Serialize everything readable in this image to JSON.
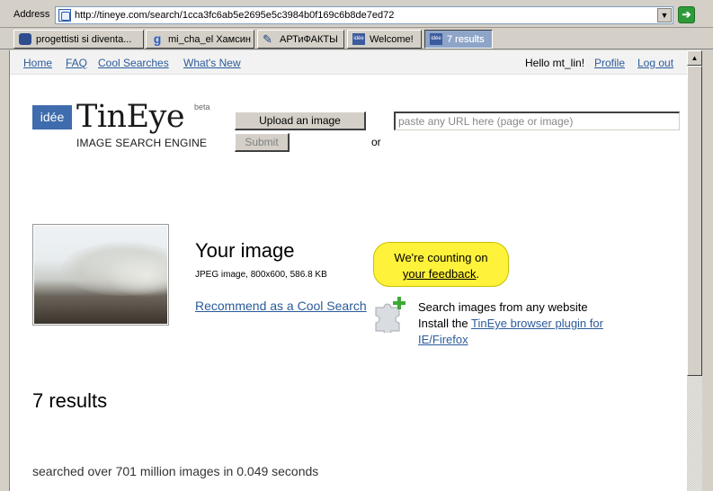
{
  "browser": {
    "address_label": "Address",
    "url": "http://tineye.com/search/1cca3fc6ab5e2695e5c3984b0f169c6b8de7ed72",
    "go_icon": "go-arrow-icon",
    "tabs": [
      {
        "label": "progettisti si diventa...",
        "icon": "person-icon"
      },
      {
        "label": "mi_cha_el Хамсин",
        "icon": "google-icon"
      },
      {
        "label": "АРТиФАКТЫ",
        "icon": "pen-icon"
      },
      {
        "label": "Welcome!",
        "icon": "idee-icon"
      },
      {
        "label": "7 results",
        "icon": "idee-icon"
      }
    ],
    "favicon_text": "idée"
  },
  "nav": {
    "home": "Home",
    "faq": "FAQ",
    "cool_searches": "Cool Searches",
    "whats_new": "What's New",
    "greeting": "Hello mt_lin!",
    "profile": "Profile",
    "logout": "Log out"
  },
  "logo": {
    "badge": "idée",
    "name": "TinEye",
    "beta": "beta",
    "subtitle": "IMAGE SEARCH ENGINE"
  },
  "search": {
    "upload_label": "Upload an image",
    "submit_label": "Submit",
    "or": "or",
    "url_placeholder": "paste any URL here (page or image)"
  },
  "image": {
    "heading": "Your image",
    "meta": "JPEG image, 800x600, 586.8 KB",
    "recommend": "Recommend as a Cool Search"
  },
  "feedback": {
    "line1": "We're counting on",
    "link": "your feedback",
    "suffix": "."
  },
  "plugin": {
    "line1": "Search images from any website",
    "line2_prefix": "Install the ",
    "link_part1": "TinEye browser plugin for",
    "link_part2": "IE/Firefox"
  },
  "results": {
    "count_text": "7 results",
    "searched_text": "searched over 701 million images in 0.049 seconds"
  },
  "colors": {
    "link": "#2b5b9a",
    "feedback_bg": "#fff23a",
    "logo_badge": "#3e6cac"
  }
}
